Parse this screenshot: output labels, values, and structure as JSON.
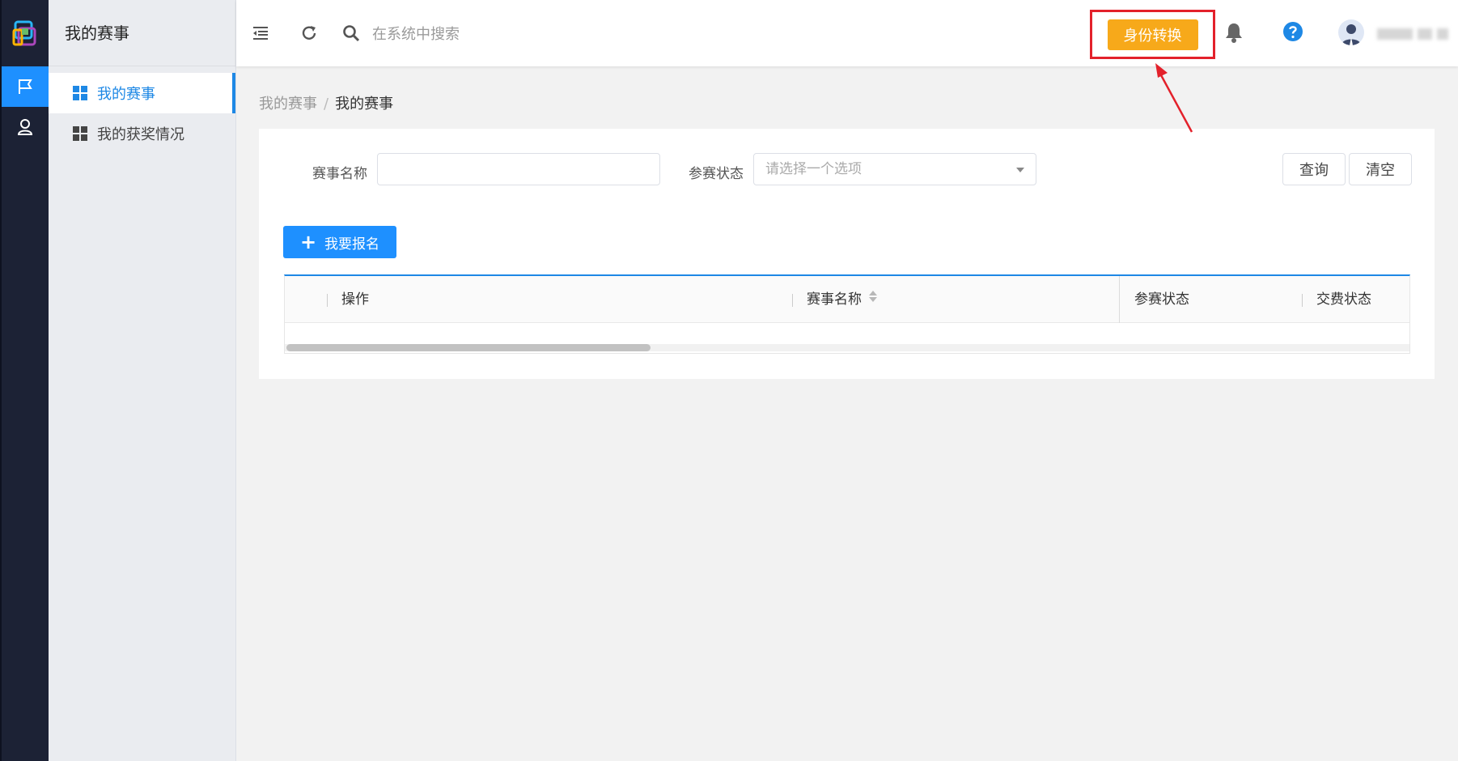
{
  "sidebar": {
    "title": "我的赛事",
    "items": [
      {
        "label": "我的赛事",
        "active": true
      },
      {
        "label": "我的获奖情况",
        "active": false
      }
    ]
  },
  "topbar": {
    "search_placeholder": "在系统中搜索",
    "switch_label": "身份转换"
  },
  "breadcrumb": {
    "parent": "我的赛事",
    "separator": "/",
    "current": "我的赛事"
  },
  "filters": {
    "name_label": "赛事名称",
    "name_value": "",
    "status_label": "参赛状态",
    "status_placeholder": "请选择一个选项",
    "query_label": "查询",
    "clear_label": "清空"
  },
  "actions": {
    "signup_label": "我要报名"
  },
  "table": {
    "columns": [
      "操作",
      "赛事名称",
      "参赛状态",
      "交费状态"
    ]
  },
  "colors": {
    "accent": "#1e90ff",
    "switch_button": "#f7a91a",
    "highlight_box": "#e3212b",
    "rail_bg": "#1c2235"
  },
  "icons": [
    "logo-icon",
    "flag-icon",
    "user-icon",
    "collapse-menu-icon",
    "refresh-icon",
    "search-icon",
    "bell-icon",
    "help-icon",
    "avatar",
    "sort-icon",
    "plus-icon"
  ]
}
